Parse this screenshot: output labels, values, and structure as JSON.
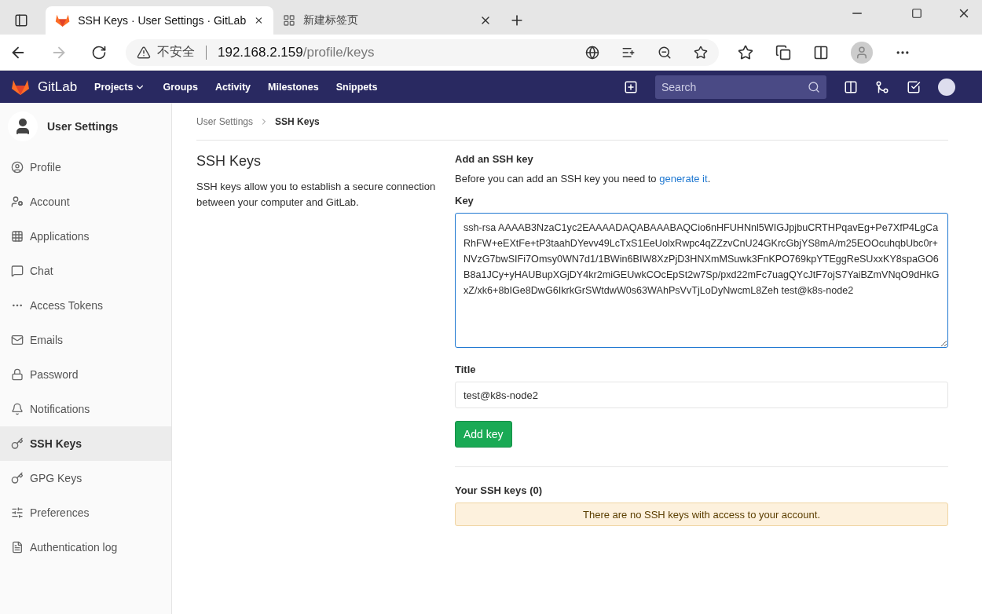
{
  "browser": {
    "tabs": [
      {
        "title": "SSH Keys · User Settings · GitLab",
        "selected": true,
        "kind": "gitlab"
      },
      {
        "title": "新建标签页",
        "selected": false,
        "kind": "blank"
      }
    ],
    "address": {
      "security": "不安全",
      "host": "192.168.2.159",
      "path": "/profile/keys"
    }
  },
  "navbar": {
    "brand": "GitLab",
    "links": [
      {
        "label": "Projects",
        "dropdown": true
      },
      {
        "label": "Groups",
        "dropdown": false
      },
      {
        "label": "Activity",
        "dropdown": false
      },
      {
        "label": "Milestones",
        "dropdown": false
      },
      {
        "label": "Snippets",
        "dropdown": false
      }
    ],
    "search": {
      "placeholder": "Search"
    }
  },
  "sidebar": {
    "title": "User Settings",
    "items": [
      {
        "label": "Profile",
        "selected": false
      },
      {
        "label": "Account",
        "selected": false
      },
      {
        "label": "Applications",
        "selected": false
      },
      {
        "label": "Chat",
        "selected": false
      },
      {
        "label": "Access Tokens",
        "selected": false
      },
      {
        "label": "Emails",
        "selected": false
      },
      {
        "label": "Password",
        "selected": false
      },
      {
        "label": "Notifications",
        "selected": false
      },
      {
        "label": "SSH Keys",
        "selected": true
      },
      {
        "label": "GPG Keys",
        "selected": false
      },
      {
        "label": "Preferences",
        "selected": false
      },
      {
        "label": "Authentication log",
        "selected": false
      }
    ]
  },
  "breadcrumb": [
    "User Settings",
    "SSH Keys"
  ],
  "section": {
    "title": "SSH Keys",
    "description": "SSH keys allow you to establish a secure connection between your computer and GitLab."
  },
  "form": {
    "heading": "Add an SSH key",
    "intro": "Before you can add an SSH key you need to",
    "intro_link": "generate it",
    "intro_end": ".",
    "key_label": "Key",
    "key_value": "ssh-rsa AAAAB3NzaC1yc2EAAAADAQABAAABAQCio6nHFUHNnl5WIGJpjbuCRTHPqavEg+Pe7XfP4LgCaRhFW+eEXtFe+tP3taahDYevv49LcTxS1EeUolxRwpc4qZZzvCnU24GKrcGbjYS8mA/m25EOOcuhqbUbc0r+NVzG7bwSIFi7Omsy0WN7d1/1BWin6BIW8XzPjD3HNXmMSuwk3FnKPO769kpYTEggReSUxxKY8spaGO6B8a1JCy+yHAUBupXGjDY4kr2miGEUwkCOcEpSt2w7Sp/pxd22mFc7uagQYcJtF7ojS7YaiBZmVNqO9dHkGxZ/xk6+8bIGe8DwG6IkrkGrSWtdwW0s63WAhPsVvTjLoDyNwcmL8Zeh test@k8s-node2",
    "title_label": "Title",
    "title_value": "test@k8s-node2",
    "button": "Add key"
  },
  "keys_list": {
    "heading": "Your SSH keys (0)",
    "empty_message": "There are no SSH keys with access to your account."
  }
}
